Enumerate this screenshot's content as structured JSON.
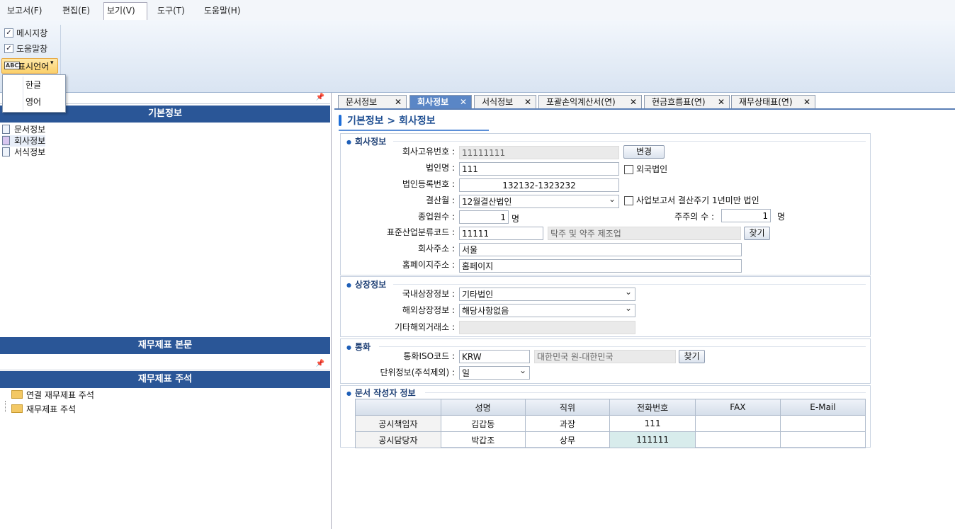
{
  "menu": {
    "items": [
      "보고서(F)",
      "편집(E)",
      "보기(V)",
      "도구(T)",
      "도움말(H)"
    ],
    "active_index": 2
  },
  "ribbon": {
    "message_window": {
      "label": "메시지창",
      "checked": true
    },
    "help_window": {
      "label": "도움말창",
      "checked": true
    },
    "display_language": {
      "label": "표시언어",
      "icon": "abc-language-icon"
    },
    "language_options": [
      "한글",
      "영어"
    ]
  },
  "left": {
    "basic_info_header": "기본정보",
    "tree": [
      "문서정보",
      "회사정보",
      "서식정보"
    ],
    "fs_body_header": "재무제표 본문",
    "fs_notes_header": "재무제표 주석",
    "notes_tree": [
      "연결 재무제표 주석",
      "재무제표 주석"
    ]
  },
  "tabs": [
    {
      "label": "문서정보",
      "active": false
    },
    {
      "label": "회사정보",
      "active": true
    },
    {
      "label": "서식정보",
      "active": false
    },
    {
      "label": "포괄손익계산서(연)",
      "active": false
    },
    {
      "label": "현금흐름표(연)",
      "active": false
    },
    {
      "label": "재무상태표(연)",
      "active": false
    }
  ],
  "breadcrumb": "기본정보 > 회사정보",
  "company": {
    "title": "회사정보",
    "unique_no_label": "회사고유번호 :",
    "unique_no": "11111111",
    "change_btn": "변경",
    "corp_name_label": "법인명 :",
    "corp_name": "111",
    "foreign_corp_label": "외국법인",
    "corp_reg_label": "법인등록번호 :",
    "corp_reg": "132132-1323232",
    "settlement_label": "결산월 :",
    "settlement": "12월결산법인",
    "short_period_label": "사업보고서 결산주기 1년미만 법인",
    "employees_label": "종업원수 :",
    "employees": "1",
    "employees_unit": "명",
    "shareholders_label": "주주의 수 :",
    "shareholders": "1",
    "shareholders_unit": "명",
    "industry_code_label": "표준산업분류코드 :",
    "industry_code": "11111",
    "industry_name": "탁주 및 약주 제조업",
    "find_btn": "찾기",
    "address_label": "회사주소 :",
    "address": "서울",
    "homepage_label": "홈페이지주소 :",
    "homepage": "홈페이지"
  },
  "listing": {
    "title": "상장정보",
    "domestic_label": "국내상장정보 :",
    "domestic": "기타법인",
    "overseas_label": "해외상장정보 :",
    "overseas": "해당사항없음",
    "other_exchange_label": "기타해외거래소 :",
    "other_exchange": ""
  },
  "currency": {
    "title": "통화",
    "iso_label": "통화ISO코드 :",
    "iso": "KRW",
    "iso_name": "대한민국 원-대한민국",
    "find_btn": "찾기",
    "unit_label": "단위정보(주석제외) :",
    "unit": "일"
  },
  "author": {
    "title": "문서 작성자 정보",
    "columns": [
      "",
      "성명",
      "직위",
      "전화번호",
      "FAX",
      "E-Mail"
    ],
    "rows": [
      [
        "공시책임자",
        "김갑동",
        "과장",
        "111",
        "",
        ""
      ],
      [
        "공시담당자",
        "박갑조",
        "상무",
        "111111",
        "",
        ""
      ]
    ]
  }
}
